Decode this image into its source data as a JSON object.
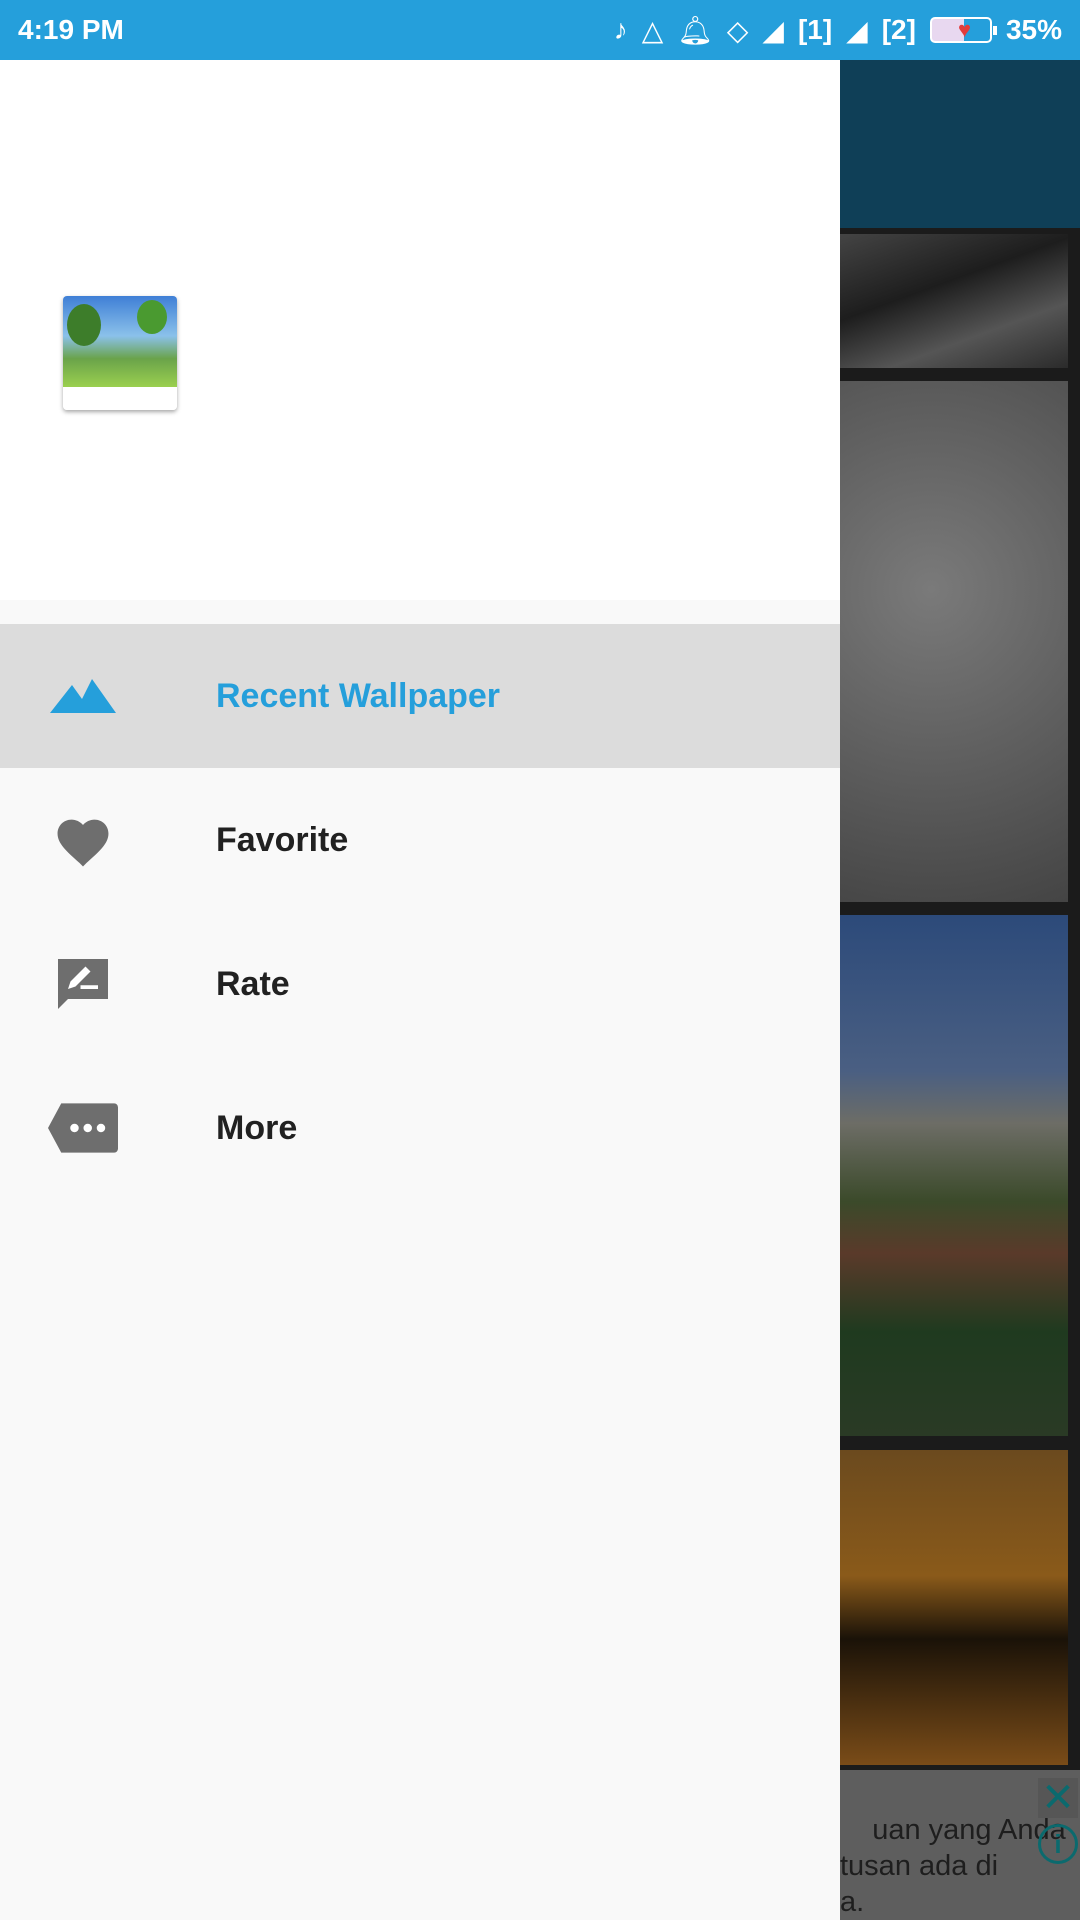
{
  "status_bar": {
    "time": "4:19 PM",
    "sim1": "[1]",
    "sim2": "[2]",
    "battery": "35%",
    "icons": [
      "music-note-icon",
      "paper-plane-icon",
      "bell-icon",
      "diamond-icon",
      "signal-icon",
      "signal-icon",
      "battery-icon"
    ]
  },
  "drawer": {
    "items": [
      {
        "label": "Recent Wallpaper",
        "icon": "landscape-icon",
        "selected": true
      },
      {
        "label": "Favorite",
        "icon": "heart-icon"
      },
      {
        "label": "Rate",
        "icon": "rate-review-icon"
      },
      {
        "label": "More",
        "icon": "more-tag-icon"
      }
    ]
  },
  "ad": {
    "text": "uan yang Anda\ntusan ada di\na.",
    "close": "✕",
    "info": "i"
  },
  "colors": {
    "accent": "#259fdb",
    "toolbar": "#0f3f57"
  }
}
